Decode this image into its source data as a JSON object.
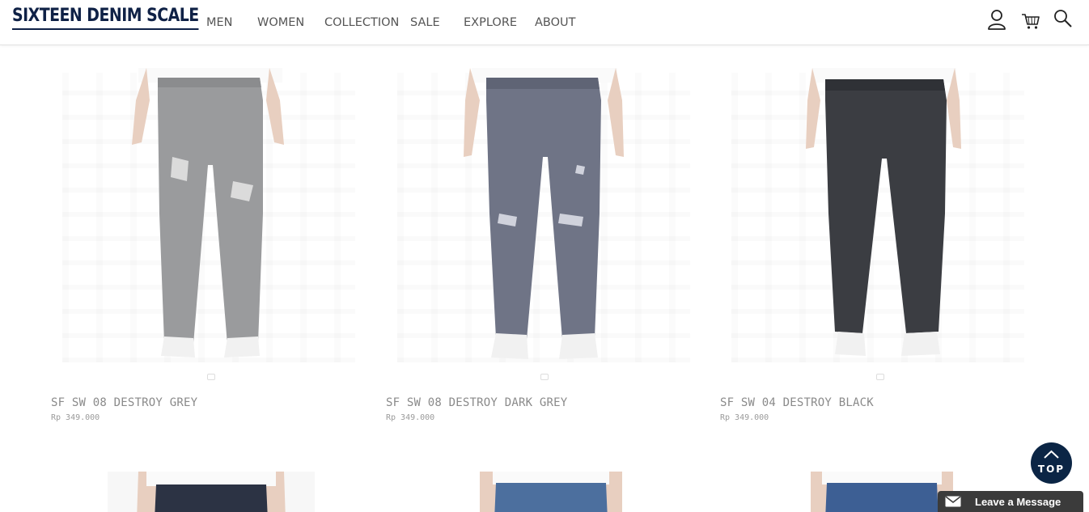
{
  "brand": {
    "name": "SIXTEEN DENIM SCALE"
  },
  "nav": {
    "items": [
      "MEN",
      "WOMEN",
      "COLLECTION",
      "SALE",
      "EXPLORE",
      "ABOUT"
    ]
  },
  "header_icons": [
    "user-icon",
    "cart-icon",
    "search-icon"
  ],
  "products": [
    {
      "name": "SF SW 08 DESTROY GREY",
      "price": "Rp 349.000",
      "denim_color": "#9a9b9d"
    },
    {
      "name": "SF SW 08 DESTROY DARK GREY",
      "price": "Rp 349.000",
      "denim_color": "#6f7486"
    },
    {
      "name": "SF SW 04 DESTROY BLACK",
      "price": "Rp 349.000",
      "denim_color": "#3b3d42"
    }
  ],
  "next_row_products": [
    {
      "denim_color": "#2c3344"
    },
    {
      "denim_color": "#4c6f9e"
    },
    {
      "denim_color": "#3d5f94"
    }
  ],
  "floating": {
    "top_label": "TOP",
    "message_label": "Leave a Message"
  },
  "colors": {
    "brand_navy": "#0f2146",
    "top_button": "#0b2545",
    "message_bar": "#3b3b3b"
  }
}
